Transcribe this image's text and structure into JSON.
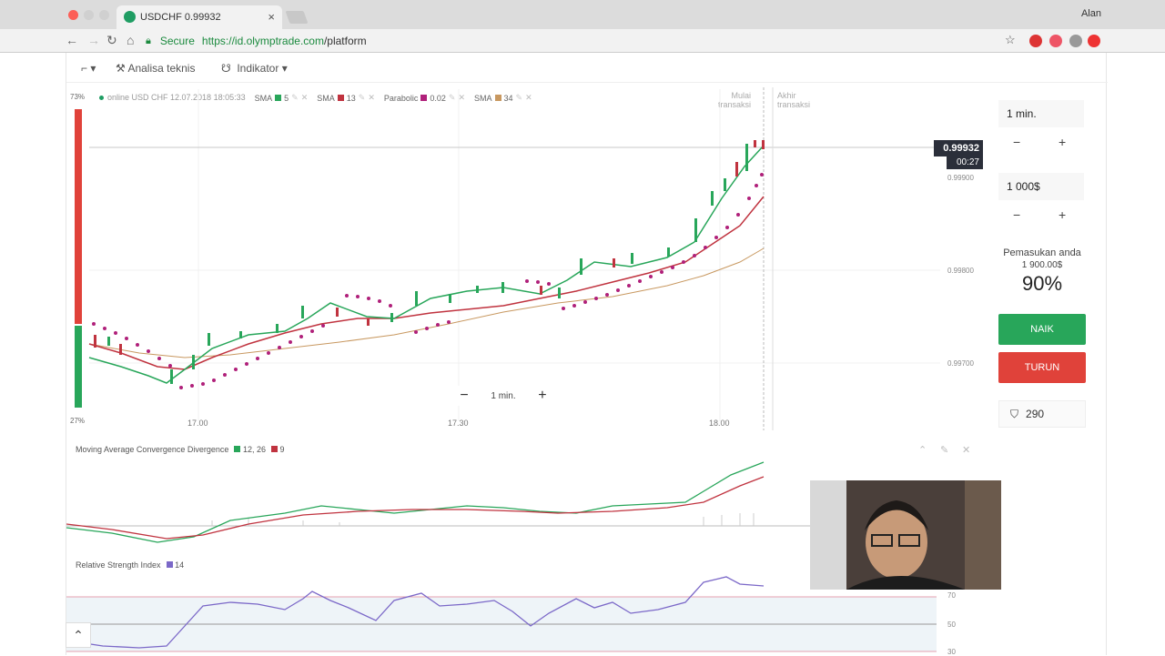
{
  "browser": {
    "tab_title": "USDCHF 0.99932",
    "user": "Alan",
    "secure_label": "Secure",
    "url_host": "https://id.olymptrade.com",
    "url_path": "/platform"
  },
  "toolbar": {
    "analysis_label": "Analisa teknis",
    "indicator_label": "Indikator"
  },
  "chart_header": {
    "status": "online USD CHF 12.07.2018 18:05:33",
    "indicators": [
      {
        "name": "SMA",
        "param": "5",
        "color": "#28a65a"
      },
      {
        "name": "SMA",
        "param": "13",
        "color": "#c0333f"
      },
      {
        "name": "Parabolic",
        "param": "0.02",
        "color": "#b0207a"
      },
      {
        "name": "SMA",
        "param": "34",
        "color": "#c89860"
      }
    ],
    "start_label": "Mulai\ntransaksi",
    "end_label": "Akhir\ntransaksi"
  },
  "price": {
    "current": "0.99932",
    "countdown": "00:27",
    "y_ticks": [
      "0.99900",
      "0.99800",
      "0.99700"
    ]
  },
  "sentiment": {
    "up": "73%",
    "down": "27%"
  },
  "time_axis": [
    "17.00",
    "17.30",
    "18.00"
  ],
  "zoom": {
    "label": "1 min."
  },
  "macd": {
    "title": "Moving Average Convergence Divergence",
    "params": "12, 26",
    "signal": "9"
  },
  "rsi": {
    "title": "Relative Strength Index",
    "period": "14",
    "levels": [
      "70",
      "50",
      "30"
    ]
  },
  "side": {
    "duration": "1 min.",
    "amount": "1 000$",
    "payout_label": "Pemasukan anda",
    "payout_amount": "1 900.00$",
    "payout_pct": "90%",
    "up_label": "NAIK",
    "down_label": "TURUN",
    "shield_value": "290"
  }
}
